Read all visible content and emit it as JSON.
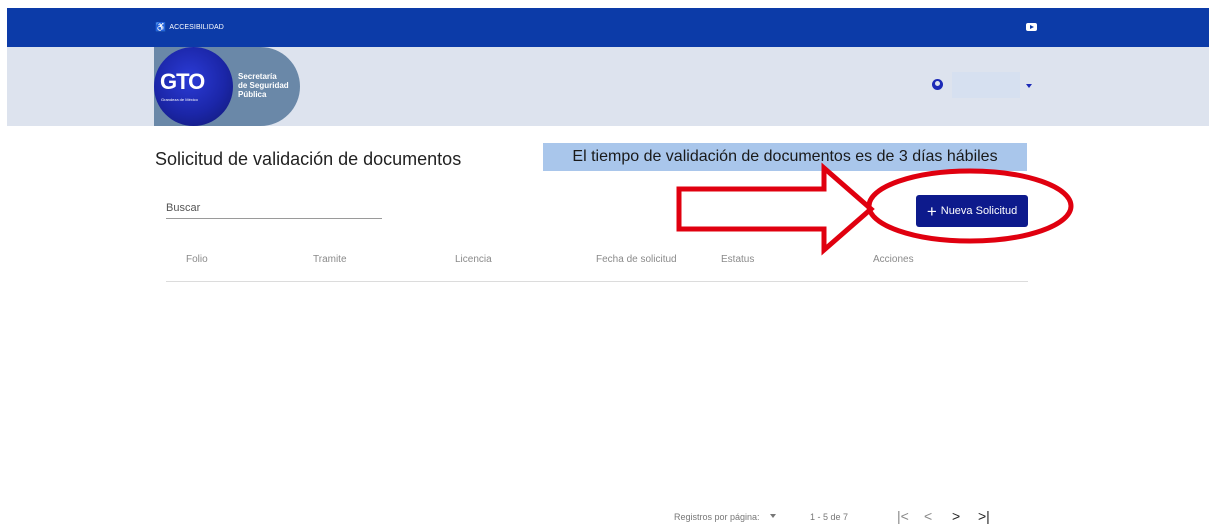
{
  "topbar": {
    "accessibility_label": "ACCESIBILIDAD",
    "icons": [
      "accessibility-icon",
      "youtube-icon"
    ]
  },
  "header": {
    "logo_text": "GTO",
    "logo_tagline": "Grandeza de México",
    "org_line1": "Secretaría",
    "org_line2": "de Seguridad",
    "org_line3": "Pública",
    "user_icon": "account-circle-icon"
  },
  "main": {
    "title": "Solicitud de validación de documentos",
    "notice": "El tiempo de validación de documentos es de 3 días hábiles",
    "search_placeholder": "Buscar",
    "new_button_label": "Nueva Solicitud",
    "table": {
      "columns": [
        "Folio",
        "Tramite",
        "Licencia",
        "Fecha de solicitud",
        "Estatus",
        "Acciones"
      ],
      "rows": []
    }
  },
  "paginator": {
    "items_per_page_label": "Registros por página:",
    "range_label": "1 - 5 de 7",
    "first_icon": "|<",
    "prev_icon": "<",
    "next_icon": ">",
    "last_icon": ">|"
  },
  "colors": {
    "topbar": "#0c3ba8",
    "header": "#dde3ee",
    "button": "#0d1a8c",
    "notice": "#a9c6eb",
    "annotation": "#e0000f"
  }
}
